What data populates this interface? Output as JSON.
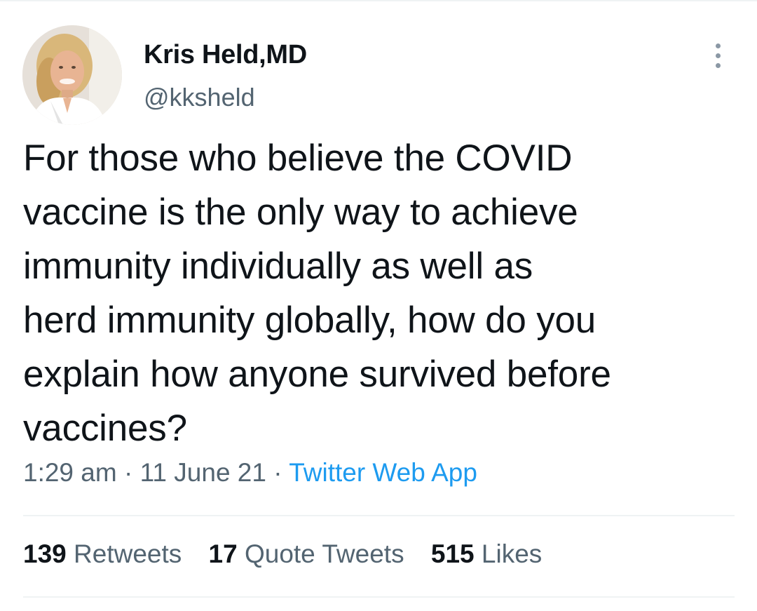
{
  "tweet": {
    "author": {
      "display_name": "Kris Held,MD",
      "handle": "@kksheld",
      "avatar_icon": "profile-photo"
    },
    "text_lines": [
      "For those who believe the COVID",
      "vaccine is the only way to achieve",
      "immunity individually as well as",
      "herd immunity globally, how do you",
      "explain how anyone survived before",
      "vaccines?"
    ],
    "time": "1:29 am",
    "date": "11 June 21",
    "source": "Twitter Web App",
    "separator": "·",
    "more_icon": "more-vertical-icon"
  },
  "stats": {
    "retweets": {
      "count": "139",
      "label": "Retweets"
    },
    "quote_tweets": {
      "count": "17",
      "label": "Quote Tweets"
    },
    "likes": {
      "count": "515",
      "label": "Likes"
    }
  },
  "colors": {
    "text": "#0f1419",
    "secondary_text": "#536471",
    "link": "#1d9bf0",
    "divider": "#eff3f4"
  }
}
